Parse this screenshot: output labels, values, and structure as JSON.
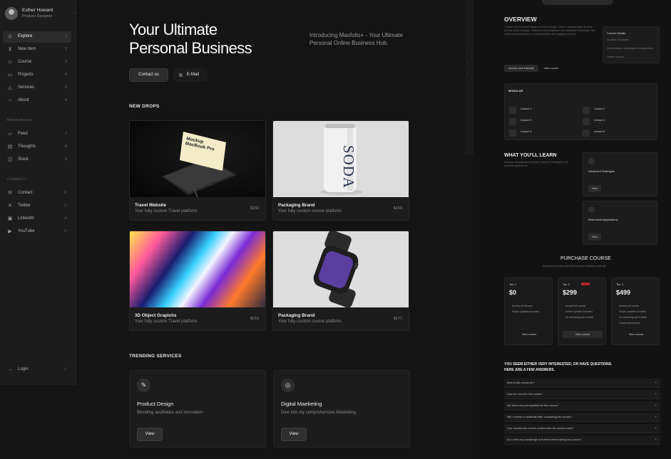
{
  "profile": {
    "name": "Esther Howard",
    "role": "Product Designer",
    "collapse_icon": "chevron-left-icon"
  },
  "nav": {
    "main": [
      {
        "label": "Explore",
        "key": "1",
        "icon": "compass-icon",
        "active": true
      },
      {
        "label": "New Item",
        "key": "2",
        "icon": "cart-icon"
      },
      {
        "label": "Course",
        "key": "3",
        "icon": "course-icon"
      },
      {
        "label": "Projects",
        "key": "4",
        "icon": "folder-icon"
      },
      {
        "label": "Services",
        "key": "5",
        "icon": "services-icon"
      },
      {
        "label": "About",
        "key": "6",
        "icon": "info-icon"
      }
    ],
    "resources_heading": "RESOURCES",
    "resources": [
      {
        "label": "Feed",
        "key": "7",
        "icon": "feed-icon"
      },
      {
        "label": "Thoughts",
        "key": "8",
        "icon": "thoughts-icon"
      },
      {
        "label": "Stack",
        "key": "9",
        "icon": "stack-icon"
      }
    ],
    "connect_heading": "CONNECT",
    "connect": [
      {
        "label": "Contact",
        "key": "C",
        "icon": "mail-icon"
      },
      {
        "label": "Twitter",
        "key": "↗",
        "icon": "x-icon"
      },
      {
        "label": "LinkedIn",
        "key": "↗",
        "icon": "linkedin-icon"
      },
      {
        "label": "YouTube",
        "key": "↗",
        "icon": "youtube-icon"
      }
    ],
    "login": {
      "label": "Login",
      "key": "L",
      "icon": "login-icon"
    }
  },
  "hero": {
    "title_line1": "Your Ultimate",
    "title_line2": "Personal Business",
    "subtitle": "Introducing Maxfolio+ - Your Ultimate Personal Online Business Hub.",
    "contact_label": "Contact us",
    "email_label": "E-Mail"
  },
  "new_drops": {
    "heading": "NEW DROPS",
    "cards": [
      {
        "title": "Travel  Website",
        "desc": "Your fully custom Travel platform.",
        "price": "$150",
        "mockup_text": "Mockup MacBook Pro"
      },
      {
        "title": "Packaging Brand",
        "desc": "Your fully custom course platform.",
        "price": "$159",
        "can_text": "SODA"
      },
      {
        "title": "3D Object Grapichs",
        "desc": "Your fully custom Travel platform.",
        "price": "$210"
      },
      {
        "title": "Packaging Brand",
        "desc": "Your fully custom course platform.",
        "price": "$177"
      }
    ]
  },
  "trending": {
    "heading": "TRENDING SERVICES",
    "items": [
      {
        "title": "Product Design",
        "desc": "Blending aesthetics and innovation",
        "button": "View",
        "icon": "pen-tool-icon"
      },
      {
        "title": "Digital Maeketing",
        "desc": "Dive into my comprehensive Maeketing.",
        "button": "View",
        "icon": "target-icon"
      }
    ]
  },
  "overview": {
    "title": "OVERVIEW",
    "intro": "\"Unlock Your Potential: Master the Art of Design\" offers a transformative journey into the world of design. Guided for both beginners and seasoned enthusiasts, this course understanding in a comprehensive and engaging manner.",
    "details_title": "Course Details",
    "details": [
      "Duration of 8 weeks",
      "Video lectures, downloads & Assignments",
      "Lifetime access"
    ],
    "btn_primary": "Access now instantly",
    "btn_secondary": "View course"
  },
  "modular": {
    "title": "MODULAR",
    "lessons": [
      "Lesson 1",
      "Lesson 2",
      "Lesson 3",
      "Lesson 4",
      "Lesson 5",
      "Lesson 6"
    ]
  },
  "learn": {
    "title": "WHAT YOU'LL LEARN",
    "desc": "Discover foundational concepts, advanced strategies, and practical applications.",
    "items": [
      {
        "title": "Advanced Strategies",
        "button": "View"
      },
      {
        "title": "Real-world Applications",
        "button": "View"
      }
    ]
  },
  "purchase": {
    "title": "PURCHASE COURSE",
    "subtitle": "Start your journey now and let your business take off",
    "tiers": [
      {
        "name": "Tier 1",
        "price": "$0",
        "features": [
          "Access all lessons",
          "Future updates included"
        ],
        "button": "View course"
      },
      {
        "name": "Tier 2",
        "price": "$299",
        "features": [
          "Access full course",
          "Future updates included",
          "1h mentoring call to AMA"
        ],
        "button": "View course"
      },
      {
        "name": "Tier 3",
        "price": "$499",
        "features": [
          "Access full course",
          "Future updates included",
          "1h mentoring call to AMA",
          "Community access"
        ],
        "button": "View course"
      }
    ]
  },
  "faq": {
    "title_line1": "YOU SEEM EITHER VERY INTERESTED, OR HAVE QUESTIONS.",
    "title_line2": "HERE ARE A FEW ANSWERS.",
    "questions": [
      "Who is this course for?",
      "How do I enroll in the course?",
      "Are there any prerequisites for this course?",
      "Will I receive a certificate after completing the course?",
      "Can I access the course content after the course ends?",
      "Do I need any knowledge in Framer before taking this course?"
    ]
  }
}
